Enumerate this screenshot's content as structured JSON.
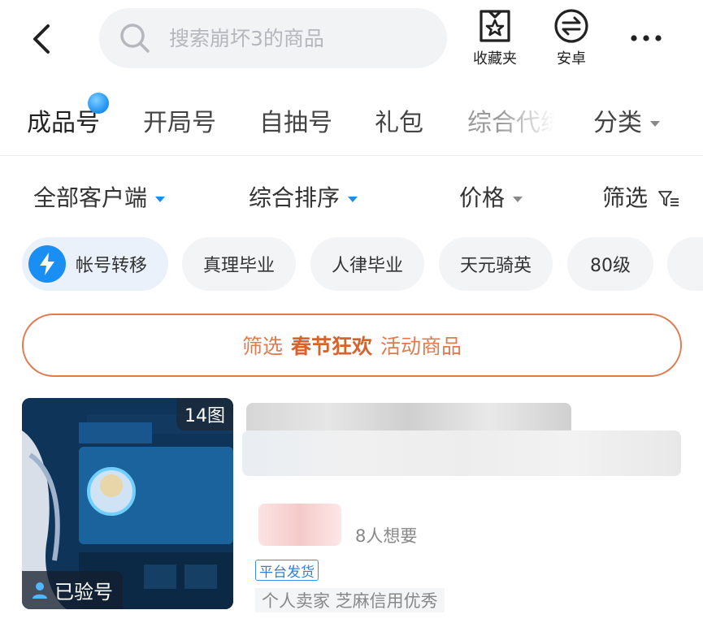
{
  "header": {
    "back_icon": "chevron-left-icon",
    "search_placeholder": "搜索崩坏3的商品",
    "favorites_label": "收藏夹",
    "favorites_icon": "star-box-icon",
    "platform_label": "安卓",
    "platform_icon": "swap-circle-icon",
    "more_icon": "more-horizontal-icon"
  },
  "tabs": [
    {
      "label": "成品号",
      "active": true
    },
    {
      "label": "开局号"
    },
    {
      "label": "自抽号"
    },
    {
      "label": "礼包"
    },
    {
      "label": "综合代练"
    },
    {
      "label": "分类"
    }
  ],
  "sortbar": {
    "client": "全部客户端",
    "sort": "综合排序",
    "price": "价格",
    "filter": "筛选"
  },
  "chips": [
    {
      "label": "帐号转移",
      "icon": "lightning-icon"
    },
    {
      "label": "真理毕业"
    },
    {
      "label": "人律毕业"
    },
    {
      "label": "天元骑英"
    },
    {
      "label": "80级"
    }
  ],
  "promo": {
    "prefix": "筛选",
    "highlight": "春节狂欢",
    "suffix": "活动商品",
    "color": "#e07b4f"
  },
  "listing": {
    "image_count": "14图",
    "verified": "已验号",
    "want_count": "8人想要",
    "platform_tag": "平台发货",
    "seller": "个人卖家  芝麻信用优秀"
  },
  "colors": {
    "accent_blue": "#1a8ef2",
    "promo_orange": "#e07b4f"
  }
}
